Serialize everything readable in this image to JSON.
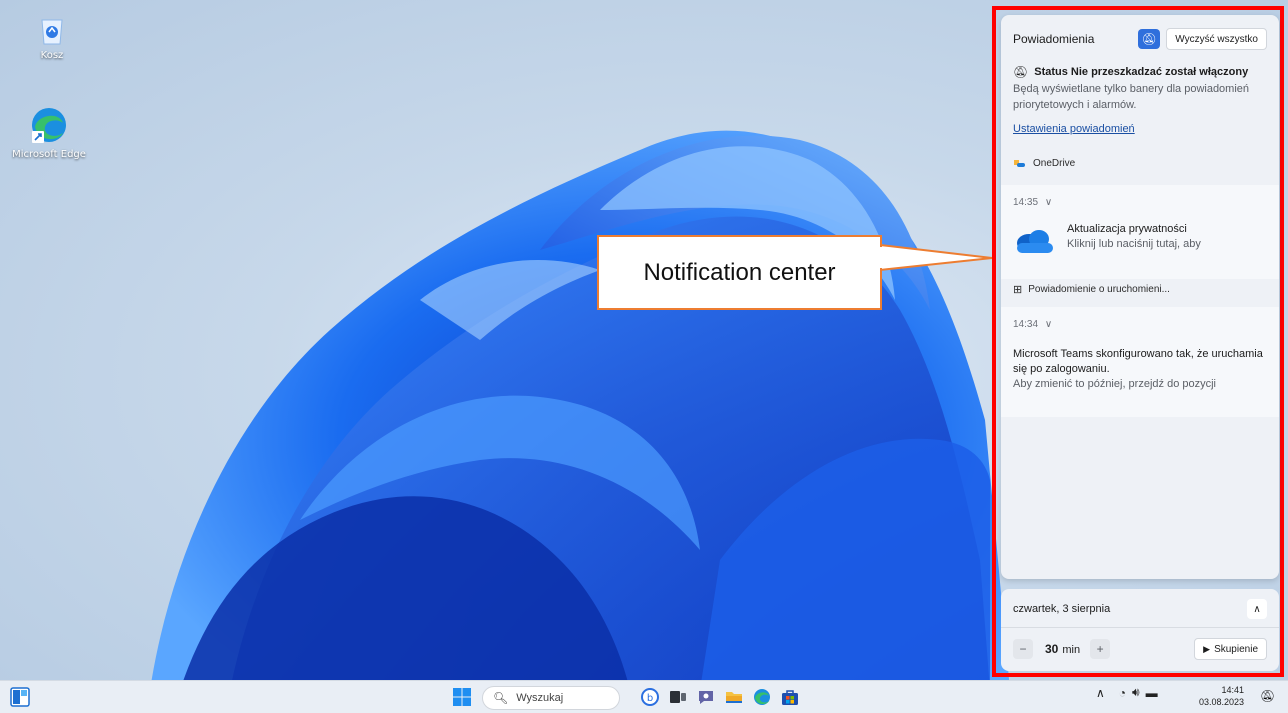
{
  "desktop": {
    "icons": [
      {
        "label": "Kosz",
        "icon": "recycle-bin-icon"
      },
      {
        "label": "Microsoft Edge",
        "icon": "edge-icon"
      }
    ]
  },
  "callout": {
    "text": "Notification center"
  },
  "notification_center": {
    "title": "Powiadomienia",
    "dnd_icon": "bell-snooze-icon",
    "clear_all_label": "Wyczyść wszystko",
    "dnd_status": {
      "heading": "Status Nie przeszkadzać został włączony",
      "description": "Będą wyświetlane tylko banery dla powiadomień priorytetowych i alarmów."
    },
    "settings_link": "Ustawienia powiadomień",
    "groups": [
      {
        "app": "OneDrive",
        "time": "14:35",
        "title": "Aktualizacja prywatności",
        "body": "Kliknij lub naciśnij tutaj, aby"
      },
      {
        "app": "Powiadomienie o uruchomieni...",
        "time": "14:34",
        "title": "Microsoft Teams skonfigurowano tak, że uruchamia się po zalogowaniu.",
        "body": "Aby zmienić to później, przejdź do pozycji"
      }
    ]
  },
  "calendar_panel": {
    "date": "czwartek, 3 sierpnia",
    "focus_minutes": "30",
    "focus_unit": "min",
    "minus_label": "−",
    "plus_label": "+",
    "focus_button": "Skupienie"
  },
  "taskbar": {
    "search_placeholder": "Wyszukaj",
    "pinned_apps": [
      "widgets-icon",
      "windows-start-icon",
      "copilot-icon",
      "task-view-icon",
      "teams-chat-icon",
      "file-explorer-icon",
      "edge-icon",
      "store-icon"
    ],
    "tray_icons": [
      "chevron-up-icon",
      "wifi-icon",
      "volume-icon",
      "battery-icon",
      "bell-snooze-icon"
    ],
    "time": "14:41",
    "date": "03.08.2023"
  },
  "colors": {
    "highlight_border": "#ff0000",
    "callout_border": "#ed7d31",
    "link": "#1a4fa3",
    "accent": "#2f6fdc"
  }
}
